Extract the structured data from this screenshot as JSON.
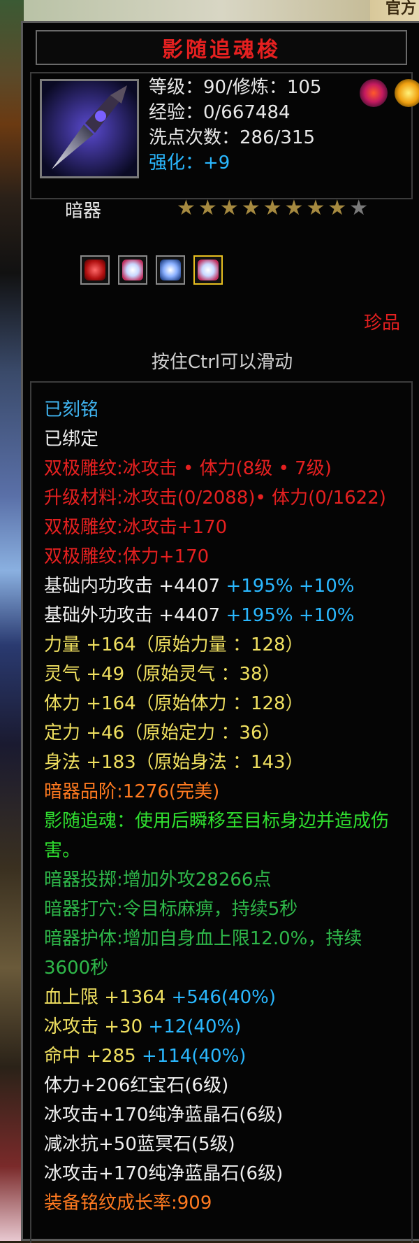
{
  "background": {
    "corner_text": "官方"
  },
  "item": {
    "name": "影随追魂梭",
    "level_line": "等级：90/修炼：105",
    "exp_line": "经验：0/667484",
    "wash_line": "洗点次数：286/315",
    "enhance_line": "强化：+9",
    "type": "暗器",
    "stars_total": 9,
    "stars_filled": 8,
    "rarity": "珍品",
    "scroll_hint": "按住Ctrl可以滑动"
  },
  "gem_slots": [
    "red-gem",
    "ice-gem",
    "blue-crystal-gem",
    "ice-gem"
  ],
  "colors": {
    "title": "#e52020",
    "cyan": "#40b4f0",
    "red": "#e52020",
    "yellow": "#f0e060",
    "green": "#30e030",
    "dark_green": "#2fb84a",
    "orange": "#ff7a20",
    "blue": "#2ab8ff"
  },
  "details": {
    "engraved": "已刻铭",
    "bound": "已绑定",
    "dual_pattern_1": "双极雕纹:冰攻击 • 体力(8级 • 7级)",
    "upgrade_material": "升级材料:冰攻击(0/2088)• 体力(0/1622)",
    "dual_pattern_2": "双极雕纹:冰攻击+170",
    "dual_pattern_3": "双极雕纹:体力+170",
    "inner_atk_base": "基础内功攻击 +4407 ",
    "inner_atk_bonus": "+195% +10%",
    "outer_atk_base": "基础外功攻击 +4407 ",
    "outer_atk_bonus": "+195% +10%",
    "strength": "力量 +164（原始力量 ：128）",
    "spirit": "灵气 +49（原始灵气 ：38）",
    "stamina": "体力 +164（原始体力 ：128）",
    "focus": "定力 +46（原始定力 ：36）",
    "agility": "身法 +183（原始身法 ：143）",
    "grade": "暗器品阶:1276(完美)",
    "skill": "影随追魂：使用后瞬移至目标身边并造成伤害。",
    "throw": "暗器投掷:增加外攻28266点",
    "acupoint": "暗器打穴:令目标麻痹，持续5秒",
    "protect": "暗器护体:增加自身血上限12.0%，持续3600秒",
    "hp_base": "血上限 +1364 ",
    "hp_bonus": "+546(40%)",
    "ice_base": "冰攻击 +30 ",
    "ice_bonus": "+12(40%)",
    "hit_base": "命中 +285 ",
    "hit_bonus": "+114(40%)",
    "gem_1": "体力+206红宝石(6级)",
    "gem_2": "冰攻击+170纯净蓝晶石(6级)",
    "gem_3": "减冰抗+50蓝冥石(5级)",
    "gem_4": "冰攻击+170纯净蓝晶石(6级)",
    "growth": "装备铭纹成长率:909"
  }
}
